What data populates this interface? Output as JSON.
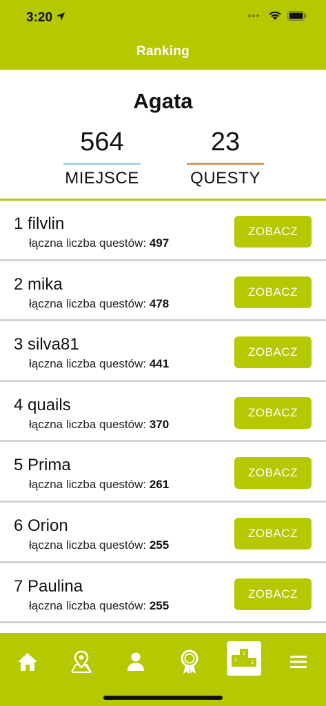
{
  "status_bar": {
    "time": "3:20"
  },
  "header": {
    "title": "Ranking"
  },
  "profile": {
    "name": "Agata",
    "rank_value": "564",
    "rank_label": "MIEJSCE",
    "quests_value": "23",
    "quests_label": "QUESTY",
    "rank_color": "#a8d4ee",
    "quests_color": "#d4995c"
  },
  "ranking": {
    "button_label": "ZOBACZ",
    "count_label": "łączna liczba questów:",
    "rows": [
      {
        "title": "1 filvlin",
        "count": "497"
      },
      {
        "title": "2 mika",
        "count": "478"
      },
      {
        "title": "3 silva81",
        "count": "441"
      },
      {
        "title": "4 quails",
        "count": "370"
      },
      {
        "title": "5 Prima",
        "count": "261"
      },
      {
        "title": "6 Orion",
        "count": "255"
      },
      {
        "title": "7 Paulina",
        "count": "255"
      }
    ]
  },
  "tabbar": {
    "accent": "#b5c800",
    "items": [
      {
        "icon": "home-icon"
      },
      {
        "icon": "map-pin-icon"
      },
      {
        "icon": "person-icon"
      },
      {
        "icon": "award-ribbon-icon"
      },
      {
        "icon": "podium-icon",
        "active": true
      },
      {
        "icon": "menu-icon"
      }
    ]
  }
}
